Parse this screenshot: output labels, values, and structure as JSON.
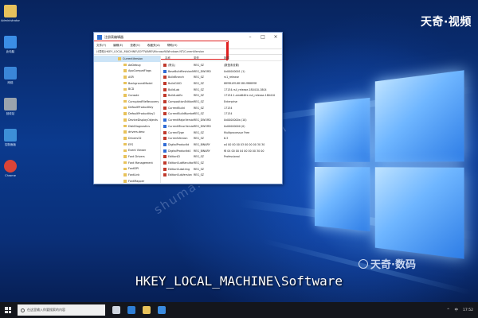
{
  "desktop": {
    "icons": [
      {
        "name": "user-folder",
        "label": "Administrator",
        "color": "#e7c15c"
      },
      {
        "name": "this-pc",
        "label": "此电脑",
        "color": "#3b8ee6"
      },
      {
        "name": "network",
        "label": "网络",
        "color": "#3a86d8"
      },
      {
        "name": "recycle-bin",
        "label": "回收站",
        "color": "#9aa3ad"
      },
      {
        "name": "control-panel",
        "label": "控制面板",
        "color": "#3d8fd8"
      },
      {
        "name": "chrome",
        "label": "Chrome",
        "color": "#db4437"
      }
    ]
  },
  "brand": {
    "top": "天奇·视频",
    "bottom": "天奇·数码"
  },
  "watermark": "shuma.tianqijun.com",
  "caption": "HKEY_LOCAL_MACHINE\\Software",
  "regedit": {
    "title": "注册表编辑器",
    "menu": [
      "文件(F)",
      "编辑(E)",
      "查看(V)",
      "收藏夹(A)",
      "帮助(H)"
    ],
    "address": "计算机\\HKEY_LOCAL_MACHINE\\SOFTWARE\\Microsoft\\Windows NT\\CurrentVersion",
    "tree": [
      {
        "label": "CurrentVersion",
        "selected": true
      },
      {
        "label": "AeDebug",
        "selected": false
      },
      {
        "label": "AppCompatFlags",
        "selected": false
      },
      {
        "label": "ASR",
        "selected": false
      },
      {
        "label": "BackgroundModel",
        "selected": false
      },
      {
        "label": "BCD",
        "selected": false
      },
      {
        "label": "Console",
        "selected": false
      },
      {
        "label": "CorruptedFileRecovery",
        "selected": false
      },
      {
        "label": "DefaultProductKey",
        "selected": false
      },
      {
        "label": "DefaultProductKey2",
        "selected": false
      },
      {
        "label": "DeviceDisplayObjects",
        "selected": false
      },
      {
        "label": "DiskDiagnostics",
        "selected": false
      },
      {
        "label": "drivers.desc",
        "selected": false
      },
      {
        "label": "Drivers32",
        "selected": false
      },
      {
        "label": "EFS",
        "selected": false
      },
      {
        "label": "Event Viewer",
        "selected": false
      },
      {
        "label": "Font Drivers",
        "selected": false
      },
      {
        "label": "Font Management",
        "selected": false
      },
      {
        "label": "FontDPI",
        "selected": false
      },
      {
        "label": "FontLink",
        "selected": false
      },
      {
        "label": "FontMapper",
        "selected": false
      }
    ],
    "columns": [
      "名称",
      "类型",
      "数据"
    ],
    "values": [
      {
        "name": "(默认)",
        "type": "REG_SZ",
        "data": "(数值未设置)",
        "kind": "str"
      },
      {
        "name": "BaseBuildRevisionNumber",
        "type": "REG_DWORD",
        "data": "0x00000001 (1)",
        "kind": "bin"
      },
      {
        "name": "BuildBranch",
        "type": "REG_SZ",
        "data": "rs1_release",
        "kind": "str"
      },
      {
        "name": "BuildGUID",
        "type": "REG_SZ",
        "data": "ffffffff-ffff-ffff-ffff-ffffffffffff",
        "kind": "str"
      },
      {
        "name": "BuildLab",
        "type": "REG_SZ",
        "data": "17134.rs4_release.180410-1804",
        "kind": "str"
      },
      {
        "name": "BuildLabEx",
        "type": "REG_SZ",
        "data": "17134.1.amd64fre.rs4_release.180410",
        "kind": "str"
      },
      {
        "name": "CompositionEditionID",
        "type": "REG_SZ",
        "data": "Enterprise",
        "kind": "str"
      },
      {
        "name": "CurrentBuild",
        "type": "REG_SZ",
        "data": "17134",
        "kind": "str"
      },
      {
        "name": "CurrentBuildNumber",
        "type": "REG_SZ",
        "data": "17134",
        "kind": "str"
      },
      {
        "name": "CurrentMajorVersionNumber",
        "type": "REG_DWORD",
        "data": "0x0000000a (10)",
        "kind": "bin"
      },
      {
        "name": "CurrentMinorVersionNumber",
        "type": "REG_DWORD",
        "data": "0x00000000 (0)",
        "kind": "bin"
      },
      {
        "name": "CurrentType",
        "type": "REG_SZ",
        "data": "Multiprocessor Free",
        "kind": "str"
      },
      {
        "name": "CurrentVersion",
        "type": "REG_SZ",
        "data": "6.3",
        "kind": "str"
      },
      {
        "name": "DigitalProductId",
        "type": "REG_BINARY",
        "data": "a4 00 00 00 03 00 00 00 30 30",
        "kind": "bin"
      },
      {
        "name": "DigitalProductId4",
        "type": "REG_BINARY",
        "data": "f8 04 00 00 04 00 00 00 30 00",
        "kind": "bin"
      },
      {
        "name": "EditionID",
        "type": "REG_SZ",
        "data": "Professional",
        "kind": "str"
      },
      {
        "name": "EditionSubManufacturer",
        "type": "REG_SZ",
        "data": "",
        "kind": "str"
      },
      {
        "name": "EditionSubstring",
        "type": "REG_SZ",
        "data": "",
        "kind": "str"
      },
      {
        "name": "EditionSubVersion",
        "type": "REG_SZ",
        "data": "",
        "kind": "str"
      }
    ]
  },
  "taskbar": {
    "search_placeholder": "在这里输入你要搜索的内容",
    "apps": [
      {
        "name": "task-view",
        "color": "#cfd6e0"
      },
      {
        "name": "edge",
        "color": "#2f7fd6"
      },
      {
        "name": "file-explorer",
        "color": "#e8c25a"
      },
      {
        "name": "regedit",
        "color": "#3a8be0"
      }
    ],
    "tray": [
      "^",
      "中",
      "17:52"
    ]
  }
}
